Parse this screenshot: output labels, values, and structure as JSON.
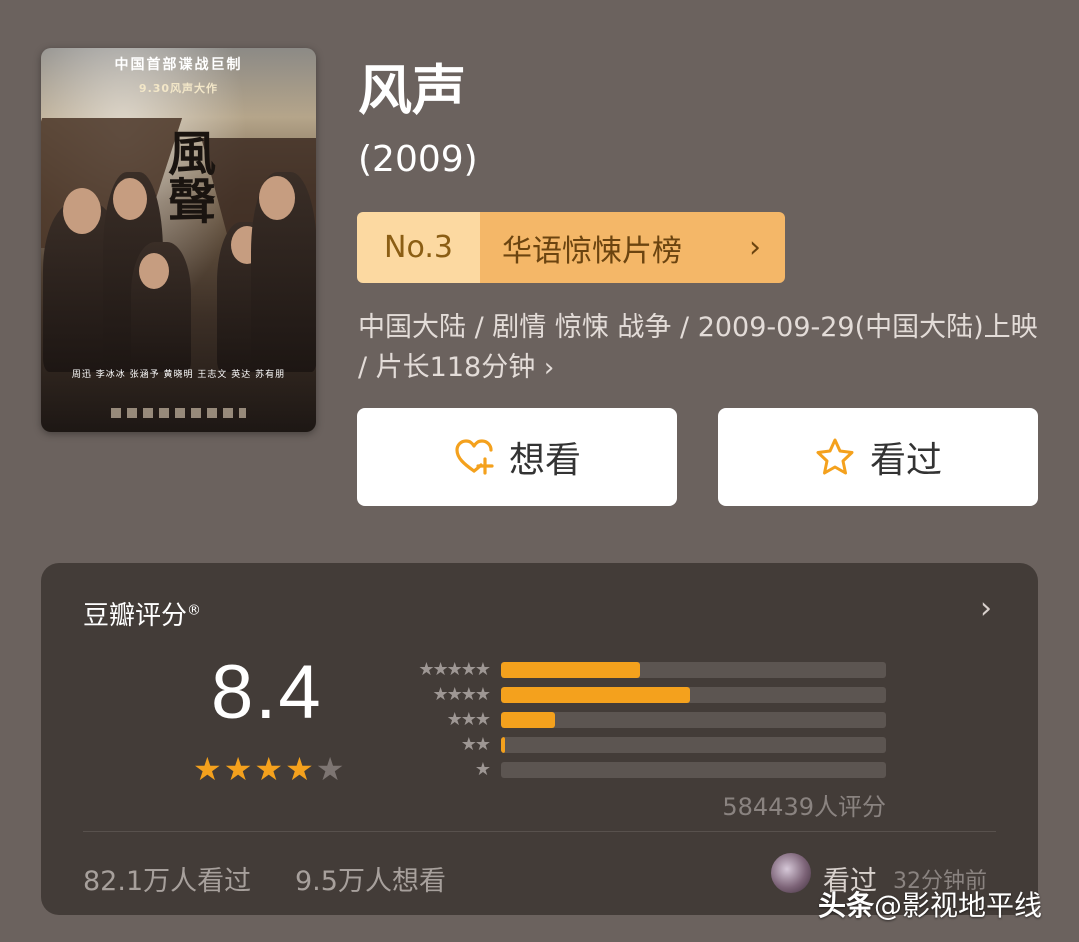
{
  "poster": {
    "tagline": "中国首部谍战巨制",
    "release_line": "9.30风声大作",
    "calligraphy": "風聲",
    "cast_line": "周迅 李冰冰 张涵予 黄晓明 王志文 英达 苏有朋"
  },
  "movie": {
    "title": "风声",
    "year": "(2009)",
    "rank_no": "No.3",
    "rank_list": "华语惊悚片榜",
    "meta_text": "中国大陆 / 剧情 惊悚 战争 / 2009-09-29(中国大陆)上映 / 片长118分钟"
  },
  "actions": {
    "want_label": "想看",
    "seen_label": "看过"
  },
  "rating": {
    "title": "豆瓣评分",
    "registered_mark": "®",
    "score": "8.4",
    "stars_filled": 4,
    "stars_total": 5,
    "vote_count": "584439人评分",
    "distribution": [
      {
        "stars": "★★★★★",
        "fraction": 0.36
      },
      {
        "stars": "★★★★",
        "fraction": 0.49
      },
      {
        "stars": "★★★",
        "fraction": 0.14
      },
      {
        "stars": "★★",
        "fraction": 0.01
      },
      {
        "stars": "★",
        "fraction": 0.0
      }
    ]
  },
  "stats": {
    "seen": "82.1万人看过",
    "want": "9.5万人想看",
    "recent_action": "看过",
    "recent_time": "32分钟前"
  },
  "watermark": {
    "brand": "头条",
    "account": "@影视地平线"
  },
  "colors": {
    "background": "#6b625e",
    "card": "#433c38",
    "accent_orange": "#f4a11d",
    "rank_light": "#fcd9a1",
    "rank_dark": "#f4b768"
  }
}
